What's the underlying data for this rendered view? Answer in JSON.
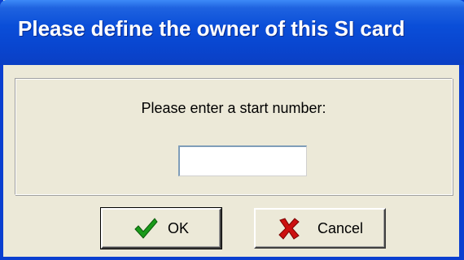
{
  "window": {
    "title": "Please define the owner of this SI card"
  },
  "form": {
    "prompt": "Please enter a start number:",
    "start_number_value": ""
  },
  "buttons": {
    "ok_label": "OK",
    "cancel_label": "Cancel"
  },
  "icons": {
    "ok": "checkmark-icon",
    "cancel": "x-mark-icon"
  },
  "colors": {
    "titlebar": "#0a4ed8",
    "dialog_bg": "#ece9d8",
    "ok_check": "#1a9a1a",
    "cancel_x": "#cc1010"
  }
}
